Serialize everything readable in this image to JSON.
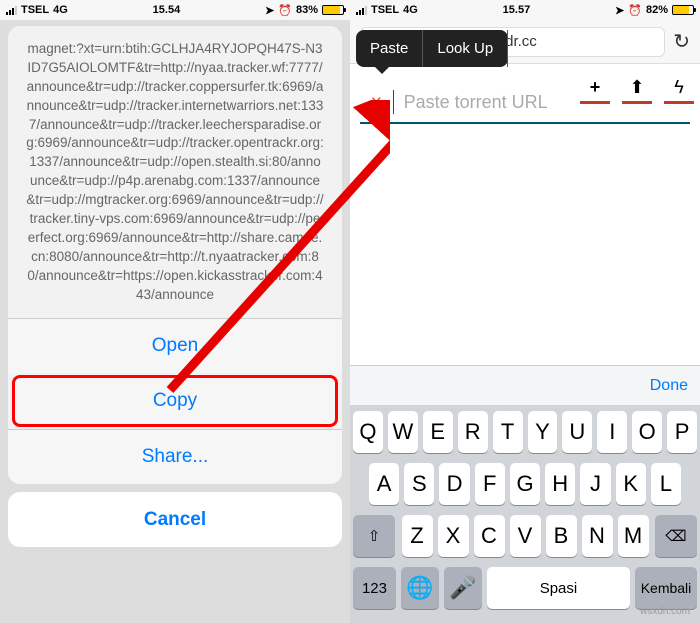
{
  "left": {
    "status": {
      "carrier": "TSEL",
      "network": "4G",
      "time": "15.54",
      "battery": "83%"
    },
    "magnet": "magnet:?xt=urn:btih:GCLHJA4RYJOPQH47S-N3ID7G5AIOLOMTF&tr=http://nyaa.tracker.wf:7777/announce&tr=udp://tracker.coppersurfer.tk:6969/announce&tr=udp://tracker.internetwarriors.net:1337/announce&tr=udp://tracker.leechersparadise.org:6969/announce&tr=udp://tracker.opentrackr.org:1337/announce&tr=udp://open.stealth.si:80/announce&tr=udp://p4p.arenabg.com:1337/announce&tr=udp://mgtracker.org:6969/announce&tr=udp://tracker.tiny-vps.com:6969/announce&tr=udp://peerfect.org:6969/announce&tr=http://share.camoe.cn:8080/announce&tr=http://t.nyaatracker.com:80/announce&tr=https://open.kickasstracker.com:443/announce",
    "buttons": {
      "open": "Open",
      "copy": "Copy",
      "share": "Share...",
      "cancel": "Cancel"
    }
  },
  "right": {
    "status": {
      "carrier": "TSEL",
      "network": "4G",
      "time": "15.57",
      "battery": "82%"
    },
    "url": "eedr.cc",
    "context": {
      "paste": "Paste",
      "lookup": "Look Up"
    },
    "input": {
      "placeholder": "Paste torrent URL"
    },
    "done": "Done",
    "keys": {
      "row1": [
        "Q",
        "W",
        "E",
        "R",
        "T",
        "Y",
        "U",
        "I",
        "O",
        "P"
      ],
      "row2": [
        "A",
        "S",
        "D",
        "F",
        "G",
        "H",
        "J",
        "K",
        "L"
      ],
      "row3": [
        "Z",
        "X",
        "C",
        "V",
        "B",
        "N",
        "M"
      ],
      "num": "123",
      "space": "Spasi",
      "return": "Kembali"
    }
  },
  "watermark": "wsxdn.com"
}
